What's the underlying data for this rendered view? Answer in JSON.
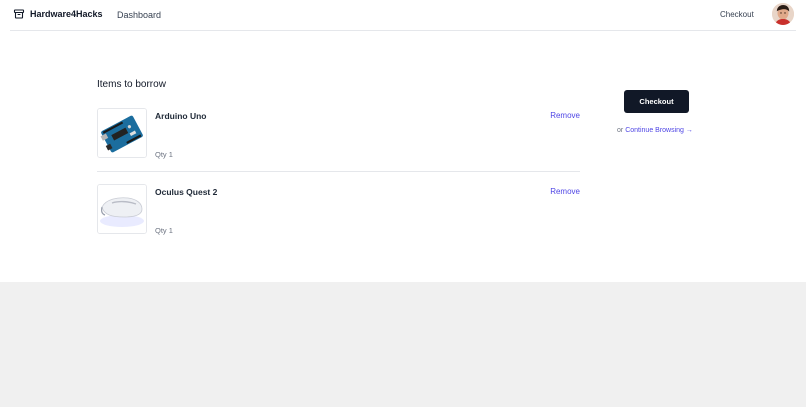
{
  "navbar": {
    "brand": "Hardware4Hacks",
    "links": {
      "dashboard": "Dashboard",
      "checkout": "Checkout"
    },
    "brand_icon": "archive-box-icon"
  },
  "cart": {
    "title": "Items to borrow",
    "items": [
      {
        "name": "Arduino Uno",
        "qty": "Qty 1",
        "remove": "Remove",
        "image": "arduino-board"
      },
      {
        "name": "Oculus Quest 2",
        "qty": "Qty 1",
        "remove": "Remove",
        "image": "vr-headset"
      }
    ]
  },
  "summary": {
    "checkout_label": "Checkout",
    "or_text": "or",
    "continue_label": "Continue Browsing →"
  },
  "colors": {
    "accent": "#4f46e5",
    "primary_button": "#111827",
    "page_bg": "#ffffff",
    "footer_bg": "#f0f0f0"
  }
}
